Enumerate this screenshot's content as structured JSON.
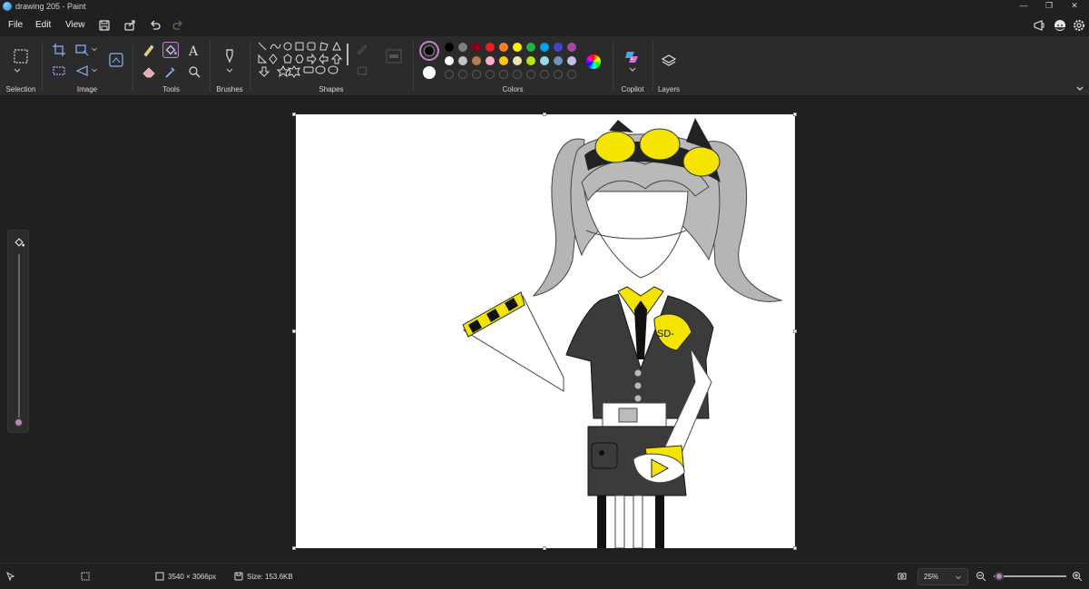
{
  "window": {
    "title": "drawing 205 - Paint"
  },
  "menu": {
    "file": "File",
    "edit": "Edit",
    "view": "View"
  },
  "ribbon": {
    "groups": {
      "selection": "Selection",
      "image": "Image",
      "tools": "Tools",
      "brushes": "Brushes",
      "shapes": "Shapes",
      "colors": "Colors",
      "copilot": "Copilot",
      "layers": "Layers"
    },
    "palette_row1": [
      "#000000",
      "#7f7f7f",
      "#880015",
      "#ed1c24",
      "#ff7f27",
      "#fff200",
      "#22b14c",
      "#00a2e8",
      "#3f48cc",
      "#a349a4"
    ],
    "palette_row2": [
      "#ffffff",
      "#c3c3c3",
      "#b97a57",
      "#ffaec9",
      "#ffc90e",
      "#efe4b0",
      "#b5e61d",
      "#99d9ea",
      "#7092be",
      "#c8bfe7"
    ],
    "primary_color": "#000000",
    "secondary_color": "#ffffff"
  },
  "status": {
    "canvas_size": "3540 × 3066px",
    "file_size": "Size: 153.6KB",
    "zoom": "25%"
  },
  "colors": {
    "accent": "#c080c8",
    "background": "#202020",
    "ribbon": "#2b2b2b"
  }
}
